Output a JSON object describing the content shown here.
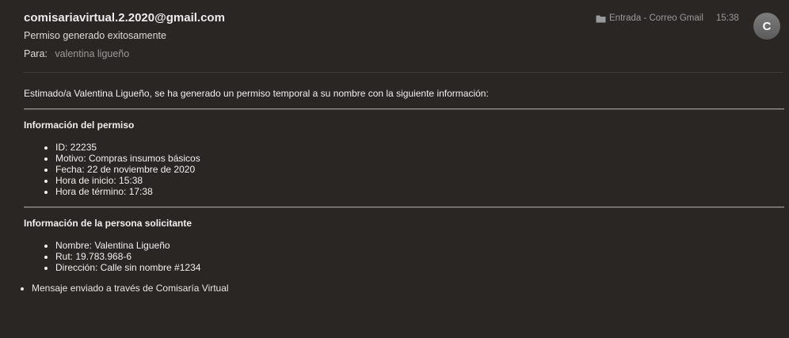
{
  "header": {
    "sender": "comisariavirtual.2.2020@gmail.com",
    "subject": "Permiso generado exitosamente",
    "to_label": "Para:",
    "to_value": "valentina ligueño",
    "mailbox": "Entrada - Correo Gmail",
    "time": "15:38",
    "avatar_initial": "C",
    "folder_icon": "folder-icon"
  },
  "body": {
    "intro": "Estimado/a Valentina Ligueño, se ha generado un permiso temporal a su nombre con la siguiente información:",
    "permit_title": "Información del permiso",
    "permit_items": [
      "ID: 22235",
      "Motivo: Compras insumos básicos",
      "Fecha: 22 de noviembre de 2020",
      "Hora de inicio: 15:38",
      "Hora de término: 17:38"
    ],
    "person_title": "Información de la persona solicitante",
    "person_items": [
      "Nombre: Valentina Ligueño",
      "Rut: 19.783.968-6",
      "Dirección: Calle sin nombre #1234"
    ],
    "footer": "Mensaje enviado a través de Comisaría Virtual"
  }
}
